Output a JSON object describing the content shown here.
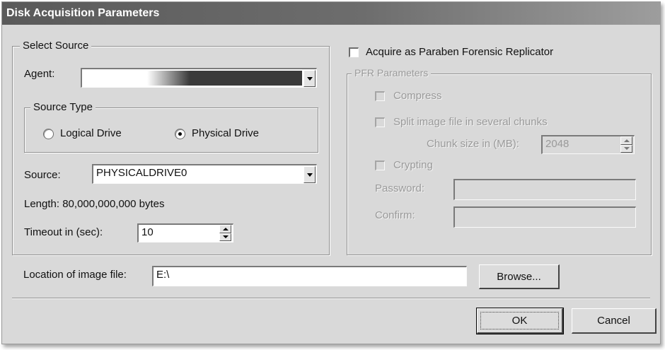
{
  "window": {
    "title": "Disk Acquisition Parameters"
  },
  "select_source": {
    "legend": "Select Source",
    "agent_label": "Agent:",
    "agent_value": "",
    "source_type": {
      "legend": "Source Type",
      "options": [
        {
          "label": "Logical Drive",
          "selected": false
        },
        {
          "label": "Physical Drive",
          "selected": true
        }
      ]
    },
    "source_label": "Source:",
    "source_value": "PHYSICALDRIVE0",
    "length_text": "Length: 80,000,000,000 bytes",
    "timeout_label": "Timeout in (sec):",
    "timeout_value": "10"
  },
  "pfr": {
    "acquire_label": "Acquire as Paraben Forensic Replicator",
    "acquire_checked": false,
    "legend": "PFR Parameters",
    "compress_label": "Compress",
    "split_label": "Split image file in several chunks",
    "chunk_label": "Chunk size in (MB):",
    "chunk_value": "2048",
    "crypting_label": "Crypting",
    "password_label": "Password:",
    "confirm_label": "Confirm:"
  },
  "location": {
    "label": "Location of image file:",
    "value": "E:\\",
    "browse_label": "Browse..."
  },
  "buttons": {
    "ok": "OK",
    "cancel": "Cancel"
  }
}
